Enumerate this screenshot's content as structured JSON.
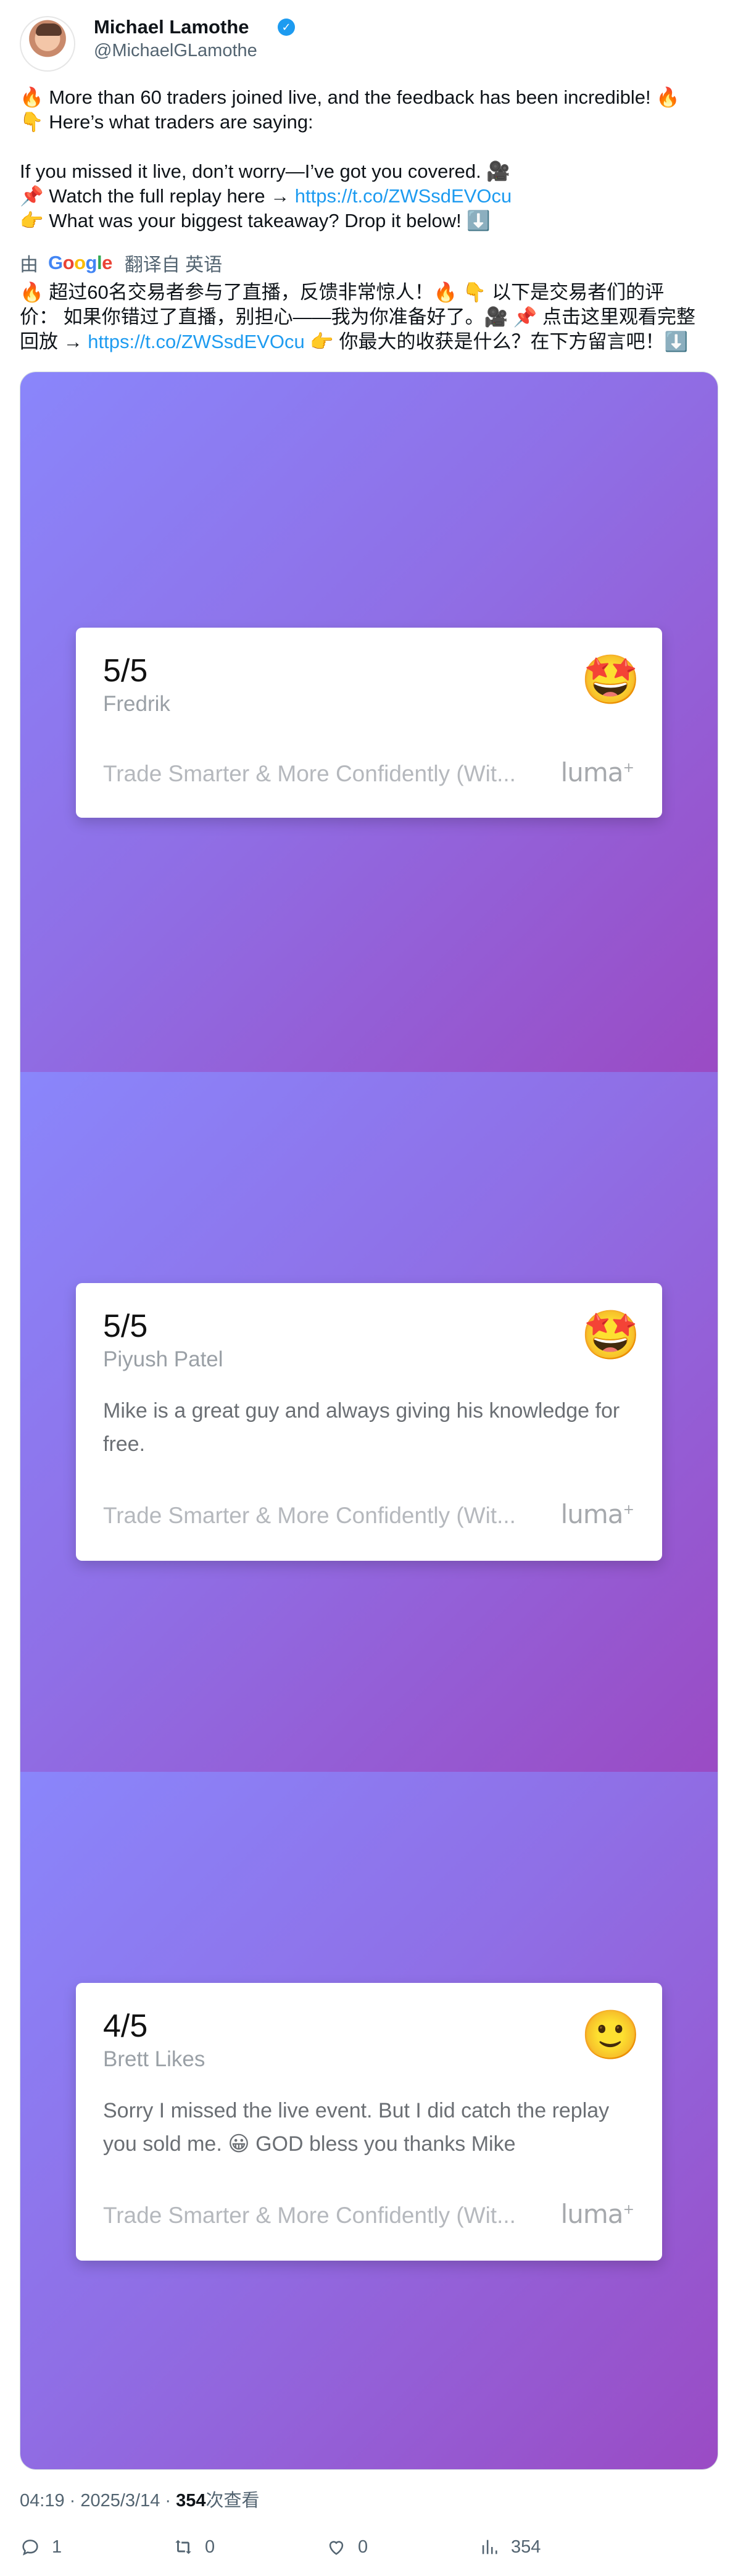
{
  "user": {
    "name": "Michael Lamothe",
    "handle": "@MichaelGLamothe"
  },
  "tweet": {
    "line1": "🔥 More than 60 traders joined live, and the feedback has been incredible! 🔥",
    "line2": "👇 Here’s what traders are saying:",
    "line3": "If you missed it live, don’t worry—I’ve got you covered. 🎥",
    "line4_prefix": "📌 Watch the full replay here → ",
    "link": "https://t.co/ZWSsdEVOcu",
    "line5": "👉 What was your biggest takeaway? Drop it below! ⬇️"
  },
  "translation": {
    "by": "由",
    "google": "Google",
    "label": "翻译自 英语",
    "text1": "🔥 超过60名交易者参与了直播，反馈非常惊人！🔥 👇 以下是交易者们的评",
    "text2": "价： 如果你错过了直播，别担心——我为你准备好了。🎥 📌 点击这里观看完整",
    "text3_prefix": "回放 → ",
    "link": "https://t.co/ZWSsdEVOcu",
    "text3_suffix": " 👉 你最大的收获是什么？在下方留言吧！⬇️"
  },
  "reviews": [
    {
      "rating": "5/5",
      "name": "Fredrik",
      "emoji": "🤩",
      "comment": "",
      "event": "Trade Smarter & More Confidently (Wit...",
      "brand": "luma"
    },
    {
      "rating": "5/5",
      "name": "Piyush Patel",
      "emoji": "🤩",
      "comment": "Mike is a great guy and always giving his knowledge for free.",
      "event": "Trade Smarter & More Confidently (Wit...",
      "brand": "luma"
    },
    {
      "rating": "4/5",
      "name": "Brett Likes",
      "emoji": "🙂",
      "comment": "Sorry I missed the live event. But I did catch the replay you sold me. 😀 GOD bless you thanks Mike",
      "event": "Trade Smarter & More Confidently (Wit...",
      "brand": "luma"
    }
  ],
  "meta": {
    "time": "04:19 · 2025/3/14 · ",
    "views": "354",
    "views_label": "次查看"
  },
  "actions": {
    "replies": "1",
    "reposts": "0",
    "likes": "0",
    "views": "354"
  },
  "colors": {
    "link": "#1d9bf0",
    "panel_gradient_start": "#8a86fb",
    "panel_gradient_end": "#9a4bc4"
  },
  "icons": [
    "reply-icon",
    "repost-icon",
    "like-icon",
    "views-icon",
    "verified-badge-icon",
    "google-logo"
  ]
}
